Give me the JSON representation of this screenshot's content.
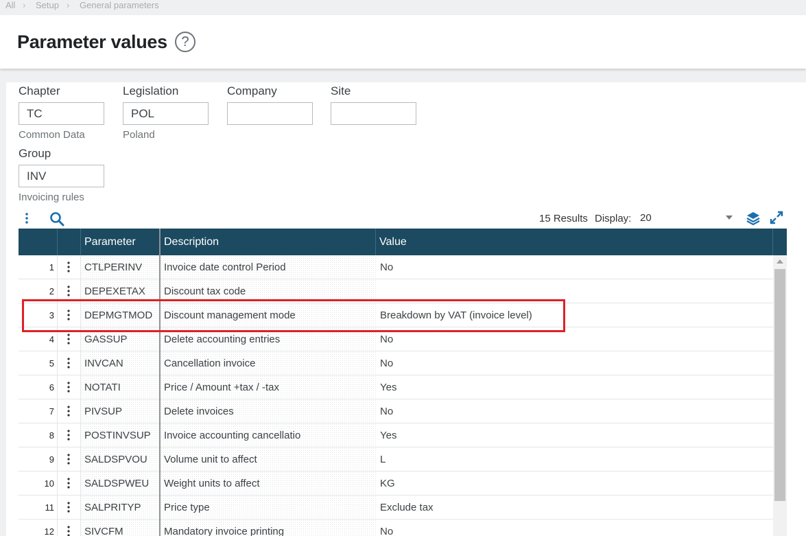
{
  "breadcrumb": {
    "items": [
      "All",
      "Setup",
      "General parameters"
    ]
  },
  "header": {
    "title": "Parameter values",
    "help_glyph": "?"
  },
  "form": {
    "chapter": {
      "label": "Chapter",
      "value": "TC",
      "description": "Common Data"
    },
    "legislation": {
      "label": "Legislation",
      "value": "POL",
      "description": "Poland"
    },
    "company": {
      "label": "Company",
      "value": ""
    },
    "site": {
      "label": "Site",
      "value": ""
    },
    "group": {
      "label": "Group",
      "value": "INV",
      "description": "Invoicing rules"
    }
  },
  "toolbar": {
    "results": "15 Results",
    "display_label": "Display:",
    "display_value": "20"
  },
  "grid": {
    "columns": [
      "Parameter",
      "Description",
      "Value"
    ],
    "rows": [
      {
        "num": "1",
        "param": "CTLPERINV",
        "desc": "Invoice date control Period",
        "value": "No"
      },
      {
        "num": "2",
        "param": "DEPEXETAX",
        "desc": "Discount tax code",
        "value": ""
      },
      {
        "num": "3",
        "param": "DEPMGTMOD",
        "desc": "Discount management mode",
        "value": "Breakdown by VAT (invoice level)"
      },
      {
        "num": "4",
        "param": "GASSUP",
        "desc": "Delete accounting entries",
        "value": "No"
      },
      {
        "num": "5",
        "param": "INVCAN",
        "desc": "Cancellation invoice",
        "value": "No"
      },
      {
        "num": "6",
        "param": "NOTATI",
        "desc": "Price / Amount +tax / -tax",
        "value": "Yes"
      },
      {
        "num": "7",
        "param": "PIVSUP",
        "desc": "Delete invoices",
        "value": "No"
      },
      {
        "num": "8",
        "param": "POSTINVSUP",
        "desc": "Invoice accounting cancellatio",
        "value": "Yes"
      },
      {
        "num": "9",
        "param": "SALDSPVOU",
        "desc": "Volume unit to affect",
        "value": "L"
      },
      {
        "num": "10",
        "param": "SALDSPWEU",
        "desc": "Weight units to affect",
        "value": "KG"
      },
      {
        "num": "11",
        "param": "SALPRITYP",
        "desc": "Price type",
        "value": "Exclude tax"
      },
      {
        "num": "12",
        "param": "SIVCFM",
        "desc": "Mandatory invoice printing",
        "value": "No"
      }
    ]
  },
  "colors": {
    "header_bg": "#1c4a60",
    "accent": "#1a6fb0",
    "highlight": "#e02027"
  }
}
